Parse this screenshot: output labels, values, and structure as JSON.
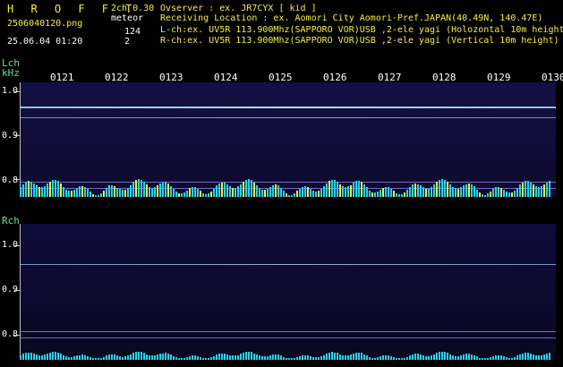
{
  "header": {
    "logo": "H R O F F T",
    "channel": "2ch 0.30",
    "file": "2506040120.png",
    "meteor_label": "meteor",
    "meteor_count": "124",
    "meteor_count2": "2",
    "datetime": "25.06.04 01:20",
    "observer": "Ovserver           : ex. JR7CYX [ kid ]",
    "location": "Receiving Location : ex. Aomori City Aomori-Pref.JAPAN(40.49N, 140.47E)",
    "lch": "L-ch:ex. UV5R 113.900Mhz(SAPPORO VOR)USB ,2-ele yagi (Holozontal 10m height)",
    "rch": "R-ch:ex. UV5R 113.900Mhz(SAPPORO VOR)USB ,2-ele yagi (Vertical 10m height)"
  },
  "left_panel": {
    "title": "Lch",
    "unit": "kHz",
    "ticks": [
      "1.0",
      "0.9",
      "0.8"
    ]
  },
  "right_panel": {
    "title": "Rch",
    "ticks": [
      "1.0",
      "0.9",
      "0.8"
    ]
  },
  "time_ticks": [
    "0121",
    "0122",
    "0123",
    "0124",
    "0125",
    "0126",
    "0127",
    "0128",
    "0129",
    "0130"
  ],
  "colors": {
    "background": "#000000",
    "text_yellow": "#f4ef43",
    "text_green": "#62e38a",
    "text_white": "#ffffff",
    "spectrogram": "#110e3d",
    "trace": "#9ed7ff",
    "activity_cyan": "#22d5e8",
    "activity_yellow": "#f7f22b"
  }
}
